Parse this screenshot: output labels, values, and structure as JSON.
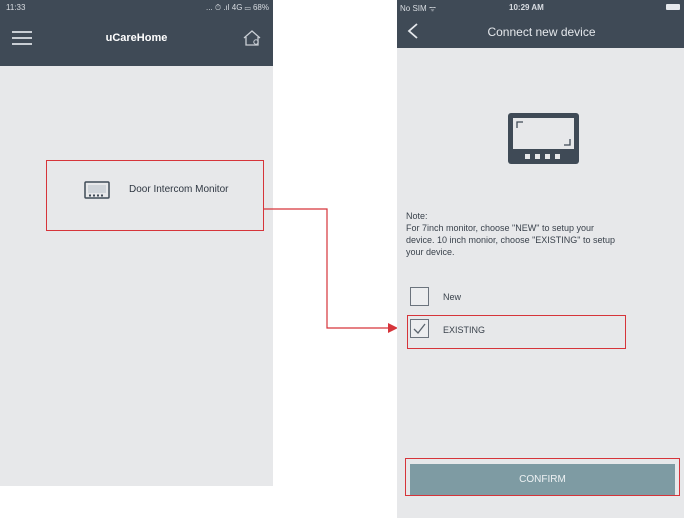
{
  "left_screen": {
    "status": {
      "time": "11:33",
      "indicators": "... ⏱ .ıl 4G ▭ 68%"
    },
    "header": {
      "title": "uCareHome",
      "menu_icon": "hamburger-menu-icon",
      "home_icon": "home-settings-icon"
    },
    "device_item": {
      "label": "Door Intercom Monitor",
      "icon": "monitor-icon"
    }
  },
  "right_screen": {
    "status": {
      "carrier": "No SIM ᯤ",
      "time": "10:29 AM"
    },
    "header": {
      "title": "Connect new device",
      "back_icon": "chevron-left-icon"
    },
    "device_icon": "monitor-icon",
    "note": {
      "heading": "Note:",
      "line1": "For 7inch monitor, choose \"NEW\" to setup your",
      "line2": "device. 10 inch monior, choose \"EXISTING\" to setup",
      "line3": "your device."
    },
    "options": [
      {
        "label": "New",
        "checked": false
      },
      {
        "label": "EXISTING",
        "checked": true
      }
    ],
    "confirm_label": "CONFIRM"
  },
  "colors": {
    "header": "#3f4a56",
    "background": "#e7e8ea",
    "highlight": "#d6343a",
    "button": "#7e9ba3"
  }
}
